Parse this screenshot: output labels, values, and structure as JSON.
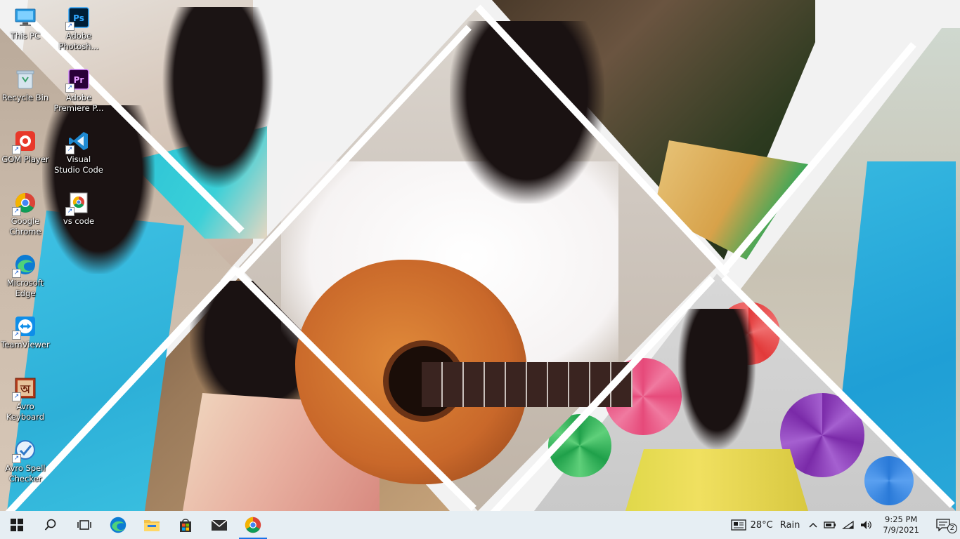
{
  "desktop": {
    "icons": [
      {
        "label": "This PC"
      },
      {
        "label": "Adobe Photosh..."
      },
      {
        "label": "Recycle Bin"
      },
      {
        "label": "Adobe Premiere P..."
      },
      {
        "label": "GOM Player"
      },
      {
        "label": "Visual Studio Code"
      },
      {
        "label": "Google Chrome"
      },
      {
        "label": "vs code"
      },
      {
        "label": "Microsoft Edge"
      },
      {
        "label": "TeamViewer"
      },
      {
        "label": "Avro Keyboard"
      },
      {
        "label": "Avro Spell Checker"
      }
    ]
  },
  "taskbar": {
    "apps": [
      "start-icon",
      "search-icon",
      "task-view-icon",
      "edge-icon",
      "file-explorer-icon",
      "store-icon",
      "mail-icon",
      "chrome-icon"
    ],
    "weather": {
      "temp": "28°C",
      "condition": "Rain"
    },
    "clock": {
      "time": "9:25 PM",
      "date": "7/9/2021"
    },
    "notifications_count": "2"
  },
  "colors": {
    "taskbar_bg": "#e6eef3",
    "accent": "#1a73e8"
  }
}
